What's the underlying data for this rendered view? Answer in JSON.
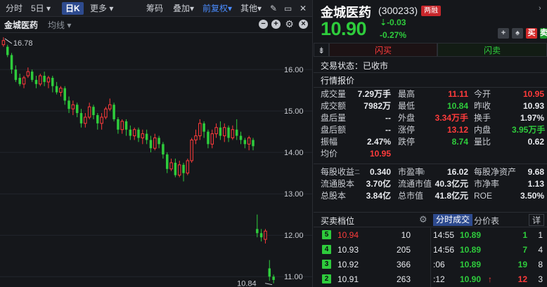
{
  "toolbar": {
    "intraday": "分时",
    "period": "5日",
    "daily_k": "日K",
    "more": "更多",
    "chips": "筹码",
    "overlay": "叠加",
    "adjust": "前复权",
    "other": "其他"
  },
  "chart_header": {
    "stock_name": "金城医药",
    "ma_label": "均线"
  },
  "chart_data": {
    "type": "candlestick",
    "y_ticks": [
      "16.00",
      "15.00",
      "14.00",
      "13.00",
      "12.00",
      "11.00"
    ],
    "y_tick_values": [
      16,
      15,
      14,
      13,
      12,
      11
    ],
    "ylim": [
      10.75,
      16.9
    ],
    "high_marker": "16.78",
    "low_marker": "10.84",
    "high_value": 16.78,
    "low_value": 10.84,
    "up_color": "#ff3b3b",
    "down_color": "#2ecc3c",
    "grid": true,
    "candles": [
      {
        "o": 16.6,
        "c": 16.7,
        "h": 16.78,
        "l": 16.55
      },
      {
        "o": 16.55,
        "c": 16.35,
        "h": 16.6,
        "l": 16.3
      },
      {
        "o": 16.35,
        "c": 16.0,
        "h": 16.4,
        "l": 15.9
      },
      {
        "o": 16.0,
        "c": 15.75,
        "h": 16.1,
        "l": 15.7
      },
      {
        "o": 15.8,
        "c": 15.65,
        "h": 15.9,
        "l": 15.6
      },
      {
        "o": 15.65,
        "c": 15.8,
        "h": 15.85,
        "l": 15.55
      },
      {
        "o": 15.85,
        "c": 15.95,
        "h": 16.05,
        "l": 15.8
      },
      {
        "o": 15.95,
        "c": 15.75,
        "h": 16.0,
        "l": 15.7
      },
      {
        "o": 15.75,
        "c": 15.65,
        "h": 15.85,
        "l": 15.55
      },
      {
        "o": 15.65,
        "c": 15.85,
        "h": 15.9,
        "l": 15.6
      },
      {
        "o": 15.85,
        "c": 15.7,
        "h": 15.95,
        "l": 15.6
      },
      {
        "o": 15.7,
        "c": 15.8,
        "h": 15.85,
        "l": 15.55
      },
      {
        "o": 15.8,
        "c": 15.6,
        "h": 15.85,
        "l": 15.45
      },
      {
        "o": 15.6,
        "c": 15.45,
        "h": 15.7,
        "l": 15.4
      },
      {
        "o": 15.45,
        "c": 15.55,
        "h": 15.6,
        "l": 15.35
      },
      {
        "o": 15.55,
        "c": 15.25,
        "h": 15.6,
        "l": 15.15
      },
      {
        "o": 15.25,
        "c": 15.05,
        "h": 15.35,
        "l": 14.95
      },
      {
        "o": 15.05,
        "c": 15.15,
        "h": 15.25,
        "l": 14.9
      },
      {
        "o": 15.15,
        "c": 14.95,
        "h": 15.2,
        "l": 14.85
      },
      {
        "o": 14.95,
        "c": 14.7,
        "h": 15.05,
        "l": 14.6
      },
      {
        "o": 14.7,
        "c": 14.85,
        "h": 14.95,
        "l": 14.6
      },
      {
        "o": 14.85,
        "c": 15.1,
        "h": 15.2,
        "l": 14.8
      },
      {
        "o": 15.1,
        "c": 14.9,
        "h": 15.15,
        "l": 14.8
      },
      {
        "o": 14.9,
        "c": 14.7,
        "h": 14.95,
        "l": 14.55
      },
      {
        "o": 14.7,
        "c": 14.85,
        "h": 14.95,
        "l": 14.55
      },
      {
        "o": 14.85,
        "c": 15.05,
        "h": 15.1,
        "l": 14.8
      },
      {
        "o": 15.05,
        "c": 15.15,
        "h": 15.3,
        "l": 15.0
      },
      {
        "o": 15.15,
        "c": 14.8,
        "h": 15.2,
        "l": 14.75
      },
      {
        "o": 14.8,
        "c": 14.55,
        "h": 14.85,
        "l": 14.45
      },
      {
        "o": 14.55,
        "c": 14.75,
        "h": 14.8,
        "l": 14.45
      },
      {
        "o": 14.75,
        "c": 14.55,
        "h": 14.8,
        "l": 14.4
      },
      {
        "o": 14.55,
        "c": 14.4,
        "h": 14.65,
        "l": 14.3
      },
      {
        "o": 14.4,
        "c": 14.55,
        "h": 14.6,
        "l": 14.3
      },
      {
        "o": 14.55,
        "c": 14.35,
        "h": 14.6,
        "l": 14.25
      },
      {
        "o": 14.35,
        "c": 14.45,
        "h": 14.55,
        "l": 14.2
      },
      {
        "o": 14.45,
        "c": 14.3,
        "h": 14.55,
        "l": 14.2
      },
      {
        "o": 14.3,
        "c": 14.1,
        "h": 14.4,
        "l": 14.0
      },
      {
        "o": 14.1,
        "c": 14.35,
        "h": 14.45,
        "l": 14.05
      },
      {
        "o": 14.35,
        "c": 14.2,
        "h": 14.4,
        "l": 14.1
      },
      {
        "o": 14.2,
        "c": 13.95,
        "h": 14.25,
        "l": 13.85
      },
      {
        "o": 13.95,
        "c": 13.6,
        "h": 14.0,
        "l": 13.5
      },
      {
        "o": 13.6,
        "c": 13.75,
        "h": 13.85,
        "l": 13.55
      },
      {
        "o": 13.75,
        "c": 13.45,
        "h": 13.85,
        "l": 13.4
      },
      {
        "o": 13.45,
        "c": 13.7,
        "h": 13.8,
        "l": 13.4
      },
      {
        "o": 13.7,
        "c": 13.5,
        "h": 13.75,
        "l": 13.3
      },
      {
        "o": 13.5,
        "c": 13.8,
        "h": 13.85,
        "l": 13.45
      },
      {
        "o": 13.8,
        "c": 14.3,
        "h": 14.35,
        "l": 13.75
      },
      {
        "o": 14.3,
        "c": 14.4,
        "h": 14.55,
        "l": 14.2
      },
      {
        "o": 14.4,
        "c": 14.7,
        "h": 14.8,
        "l": 14.3
      },
      {
        "o": 14.7,
        "c": 14.5,
        "h": 14.75,
        "l": 14.35
      },
      {
        "o": 14.5,
        "c": 14.2,
        "h": 14.55,
        "l": 14.1
      },
      {
        "o": 14.2,
        "c": 14.45,
        "h": 14.55,
        "l": 14.1
      },
      {
        "o": 14.45,
        "c": 14.6,
        "h": 14.7,
        "l": 14.35
      },
      {
        "o": 14.6,
        "c": 14.4,
        "h": 14.75,
        "l": 14.3
      },
      {
        "o": 14.4,
        "c": 14.6,
        "h": 14.7,
        "l": 14.25
      },
      {
        "o": 14.6,
        "c": 14.35,
        "h": 14.65,
        "l": 14.25
      },
      {
        "o": 14.35,
        "c": 14.55,
        "h": 14.65,
        "l": 14.3
      },
      {
        "o": 14.55,
        "c": 14.4,
        "h": 14.8,
        "l": 14.3
      },
      {
        "o": 14.4,
        "c": 14.3,
        "h": 14.5,
        "l": 14.2
      },
      {
        "o": 14.3,
        "c": 14.2,
        "h": 14.35,
        "l": 14.1
      },
      {
        "o": 14.2,
        "c": 14.35,
        "h": 14.4,
        "l": 14.05
      },
      {
        "o": 14.3,
        "c": 14.15,
        "h": 14.35,
        "l": 14.05
      },
      {
        "o": 12.15,
        "c": 12.05,
        "h": 12.5,
        "l": 11.95
      },
      {
        "o": 12.05,
        "c": 11.95,
        "h": 12.15,
        "l": 11.85
      },
      {
        "o": 11.9,
        "c": 12.1,
        "h": 12.15,
        "l": 11.8
      },
      {
        "o": 11.2,
        "c": 11.0,
        "h": 11.4,
        "l": 10.9
      },
      {
        "o": 11.0,
        "c": 10.92,
        "h": 11.05,
        "l": 10.84
      }
    ]
  },
  "quote": {
    "name": "金城医药",
    "code": "(300233)",
    "badge": "两融",
    "price": "10.90",
    "change": "-0.03",
    "change_pct": "-0.27%",
    "buy_short": "买",
    "sell_short": "卖",
    "buy_label": "闪买",
    "sell_label": "闪卖",
    "status": "交易状态：已收市",
    "section_title": "行情报价"
  },
  "stats": [
    [
      [
        "成交量",
        "7.29万手",
        "w"
      ],
      [
        "最高",
        "11.11",
        "r"
      ],
      [
        "今开",
        "10.95",
        "r"
      ]
    ],
    [
      [
        "成交额",
        "7982万",
        "w"
      ],
      [
        "最低",
        "10.84",
        "g"
      ],
      [
        "昨收",
        "10.93",
        "w"
      ]
    ],
    [
      [
        "盘后量",
        "--",
        "w"
      ],
      [
        "外盘",
        "3.34万手",
        "r"
      ],
      [
        "换手",
        "1.97%",
        "w"
      ]
    ],
    [
      [
        "盘后额",
        "--",
        "w"
      ],
      [
        "涨停",
        "13.12",
        "r"
      ],
      [
        "内盘",
        "3.95万手",
        "g"
      ]
    ],
    [
      [
        "振幅",
        "2.47%",
        "w"
      ],
      [
        "跌停",
        "8.74",
        "g"
      ],
      [
        "量比",
        "0.62",
        "w"
      ]
    ],
    [
      [
        "均价",
        "10.95",
        "r"
      ],
      [
        "",
        "",
        "w"
      ],
      [
        "",
        "",
        "w"
      ]
    ]
  ],
  "fundamentals": [
    [
      [
        "每股收益",
        "0.340"
      ],
      [
        "市盈率",
        "16.02"
      ],
      [
        "每股净资产",
        "9.68"
      ]
    ],
    [
      [
        "流通股本",
        "3.70亿"
      ],
      [
        "流通市值",
        "40.3亿元"
      ],
      [
        "市净率",
        "1.13"
      ]
    ],
    [
      [
        "总股本",
        "3.84亿"
      ],
      [
        "总市值",
        "41.8亿元"
      ],
      [
        "ROE",
        "3.50%"
      ]
    ]
  ],
  "fund_tags": [
    "二",
    "动"
  ],
  "book": {
    "title": "买卖档位",
    "tab_ticks": "分时成交",
    "tab_price": "分价表",
    "detail": "详",
    "rows": [
      {
        "lvl": "5",
        "price": "10.94",
        "vol": "10",
        "color": "r"
      },
      {
        "lvl": "4",
        "price": "10.93",
        "vol": "205",
        "color": "w"
      },
      {
        "lvl": "3",
        "price": "10.92",
        "vol": "366",
        "color": "w"
      },
      {
        "lvl": "2",
        "price": "10.91",
        "vol": "263",
        "color": "w"
      }
    ]
  },
  "ticks": [
    {
      "time": "14:55",
      "price": "10.89",
      "vol": "1",
      "n": "1",
      "arrow": ""
    },
    {
      "time": "14:56",
      "price": "10.89",
      "vol": "7",
      "n": "4",
      "arrow": ""
    },
    {
      "time": ":06",
      "price": "10.89",
      "vol": "19",
      "n": "8",
      "arrow": ""
    },
    {
      "time": ":12",
      "price": "10.90",
      "vol": "12",
      "n": "3",
      "arrow": "↑"
    }
  ]
}
